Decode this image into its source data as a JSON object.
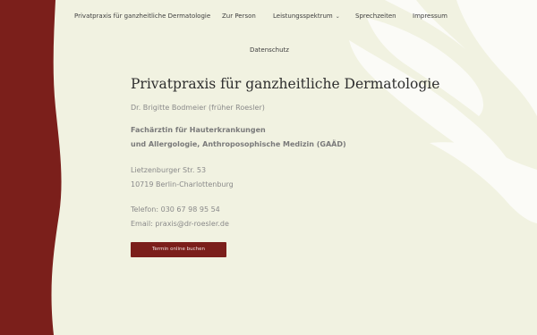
{
  "nav": {
    "items": [
      {
        "label": "Privatpraxis für ganzheitliche Dermatologie"
      },
      {
        "label": "Zur Person"
      },
      {
        "label": "Leistungsspektrum"
      },
      {
        "label": "Sprechzeiten"
      },
      {
        "label": "Impressum"
      },
      {
        "label": "Datenschutz"
      }
    ]
  },
  "main": {
    "title": "Privatpraxis für ganzheitliche Dermatologie",
    "doctor": "Dr. Brigitte Bodmeier (früher Roesler)",
    "specialty_line1": "Fachärztin für Hauterkrankungen",
    "specialty_line2": "und Allergologie, Anthroposophische Medizin (GAÄD)",
    "street": "Lietzenburger Str. 53",
    "city": "10719 Berlin-Charlottenburg",
    "phone": "Telefon: 030 67 98 95 54",
    "email": "Email: praxis@dr-roesler.de",
    "button_label": "Termin online buchen"
  },
  "colors": {
    "background": "#f1f2e1",
    "accent": "#7b1f1b"
  }
}
